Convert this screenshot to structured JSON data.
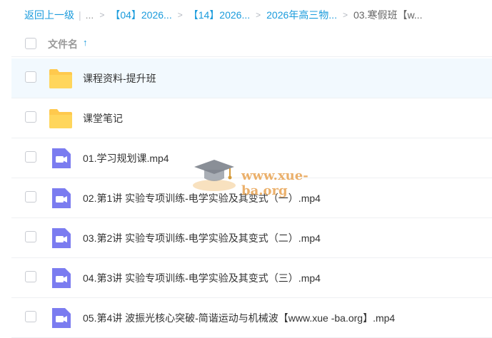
{
  "breadcrumb": {
    "back": "返回上一级",
    "separator": "|",
    "ellipsis": "...",
    "items": [
      "【04】2026...",
      "【14】2026...",
      "2026年高三物..."
    ],
    "current": "03.寒假班【w..."
  },
  "header": {
    "column_label": "文件名",
    "sort_arrow": "↑"
  },
  "files": [
    {
      "name": "课程资料-提升班",
      "type": "folder"
    },
    {
      "name": "课堂笔记",
      "type": "folder"
    },
    {
      "name": "01.学习规划课.mp4",
      "type": "video"
    },
    {
      "name": "02.第1讲 实验专项训练-电学实验及其变式（一）.mp4",
      "type": "video"
    },
    {
      "name": "03.第2讲 实验专项训练-电学实验及其变式（二）.mp4",
      "type": "video"
    },
    {
      "name": "04.第3讲 实验专项训练-电学实验及其变式（三）.mp4",
      "type": "video"
    },
    {
      "name": "05.第4讲 波振光核心突破-简谐运动与机械波【www.xue -ba.org】.mp4",
      "type": "video"
    }
  ],
  "watermark": {
    "text": "www.xue-ba.org"
  },
  "colors": {
    "accent": "#1a9bdc",
    "folder": "#ffc94d",
    "video": "#7b7cf0",
    "highlight_row": "#f2f9fe"
  }
}
